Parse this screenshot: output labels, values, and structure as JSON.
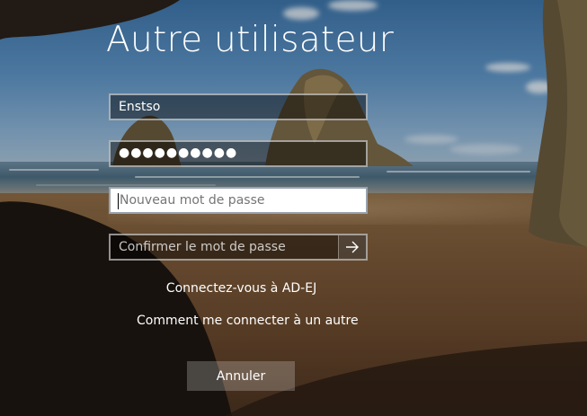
{
  "login": {
    "title": "Autre utilisateur",
    "username_value": "Enstso",
    "password_mask": "●●●●●●●●●●",
    "new_password_placeholder": "Nouveau mot de passe",
    "confirm_password_placeholder": "Confirmer le mot de passe",
    "submit_icon": "arrow-right-icon",
    "domain_link": "Connectez-vous à AD-EJ",
    "other_domain_link": "Comment me connecter à un autre",
    "cancel_label": "Annuler"
  },
  "colors": {
    "text": "#ffffff",
    "field_bg_dark": "#000000",
    "field_bg_active": "#ffffff",
    "placeholder": "#757575"
  }
}
